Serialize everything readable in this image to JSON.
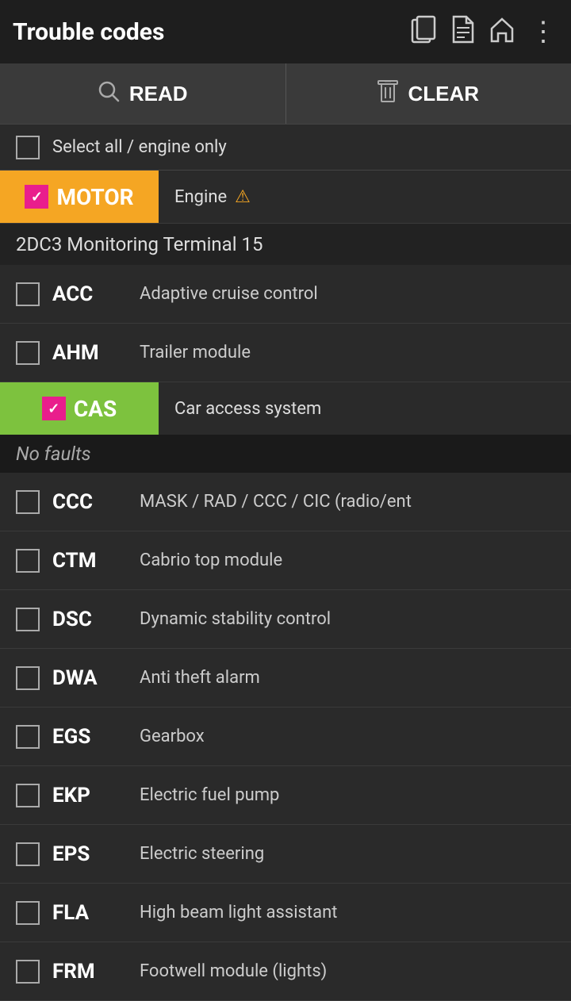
{
  "header": {
    "title": "Trouble codes",
    "icons": [
      "copy",
      "document",
      "home",
      "more"
    ]
  },
  "toolbar": {
    "read_label": "READ",
    "clear_label": "CLEAR"
  },
  "select_all": {
    "label": "Select all / engine only",
    "checked": false
  },
  "modules": [
    {
      "id": "MOTOR",
      "label": "MOTOR",
      "desc": "Engine",
      "checked": true,
      "color": "orange",
      "warning": true,
      "group_header": null,
      "no_faults": null
    }
  ],
  "items": [
    {
      "code": "ACC",
      "desc": "Adaptive cruise control",
      "checked": false
    },
    {
      "code": "AHM",
      "desc": "Trailer module",
      "checked": false
    },
    {
      "code": "CAS",
      "desc": "Car access system",
      "checked": true,
      "highlight": true
    },
    {
      "code": "CCC",
      "desc": "MASK / RAD / CCC / CIC (radio/ent",
      "checked": false
    },
    {
      "code": "CTM",
      "desc": "Cabrio top module",
      "checked": false
    },
    {
      "code": "DSC",
      "desc": "Dynamic stability control",
      "checked": false
    },
    {
      "code": "DWA",
      "desc": "Anti theft alarm",
      "checked": false
    },
    {
      "code": "EGS",
      "desc": "Gearbox",
      "checked": false
    },
    {
      "code": "EKP",
      "desc": "Electric fuel pump",
      "checked": false
    },
    {
      "code": "EPS",
      "desc": "Electric steering",
      "checked": false
    },
    {
      "code": "FLA",
      "desc": "High beam light assistant",
      "checked": false
    },
    {
      "code": "FRM",
      "desc": "Footwell module (lights)",
      "checked": false
    }
  ],
  "group": {
    "header": "2DC3 Monitoring Terminal 15",
    "no_faults": "No faults"
  },
  "colors": {
    "orange": "#f5a623",
    "green": "#7dc23e",
    "pink_check": "#e91e8c",
    "bg_dark": "#1e1e1e",
    "bg_main": "#2a2a2a"
  }
}
